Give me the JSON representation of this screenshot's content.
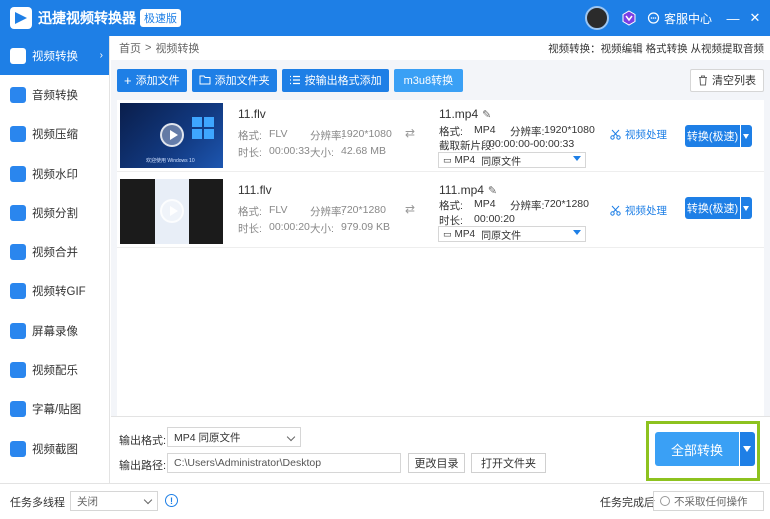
{
  "app": {
    "title": "迅捷视频转换器",
    "edition": "极速版",
    "support_label": "客服中心",
    "window_controls": [
      "minimize-icon",
      "close-icon"
    ]
  },
  "sidebar": {
    "items": [
      {
        "label": "视频转换",
        "icon": "video-convert-icon",
        "active": true
      },
      {
        "label": "音频转换",
        "icon": "audio-convert-icon"
      },
      {
        "label": "视频压缩",
        "icon": "video-compress-icon"
      },
      {
        "label": "视频水印",
        "icon": "watermark-icon"
      },
      {
        "label": "视频分割",
        "icon": "split-icon"
      },
      {
        "label": "视频合并",
        "icon": "merge-icon"
      },
      {
        "label": "视频转GIF",
        "icon": "gif-icon"
      },
      {
        "label": "屏幕录像",
        "icon": "screen-record-icon"
      },
      {
        "label": "视频配乐",
        "icon": "music-icon"
      },
      {
        "label": "字幕/贴图",
        "icon": "subtitle-icon"
      },
      {
        "label": "视频截图",
        "icon": "screenshot-icon"
      }
    ]
  },
  "breadcrumb": {
    "home": "首页",
    "sep": ">",
    "current": "视频转换",
    "quick_links": "视频转换：视频编辑 格式转换 从视频提取音频"
  },
  "toolbar": {
    "add_file": "添加文件",
    "add_folder": "添加文件夹",
    "add_by_format": "按输出格式添加",
    "m3u8": "m3u8转换",
    "clear_list": "清空列表"
  },
  "files": [
    {
      "src_name": "11.flv",
      "format_label": "格式:",
      "format": "FLV",
      "res_label": "分辨率:",
      "resolution": "1920*1080",
      "duration_label": "时长:",
      "duration": "00:00:33",
      "size_label": "大小:",
      "size": "42.68 MB",
      "out_name": "11.mp4",
      "out_format_label": "格式:",
      "out_format": "MP4",
      "out_res_label": "分辨率:",
      "out_resolution": "1920*1080",
      "clip_label": "截取新片段:",
      "clip": "00:00:00-00:00:33",
      "preset": "MP4",
      "preset_quality": "同原文件",
      "thumb_caption": "欢迎使用 Windows 10",
      "process_label": "视频处理",
      "convert_label": "转换(极速)"
    },
    {
      "src_name": "111.flv",
      "format_label": "格式:",
      "format": "FLV",
      "res_label": "分辨率:",
      "resolution": "720*1280",
      "duration_label": "时长:",
      "duration": "00:00:20",
      "size_label": "大小:",
      "size": "979.09 KB",
      "out_name": "111.mp4",
      "out_format_label": "格式:",
      "out_format": "MP4",
      "out_res_label": "分辨率:",
      "out_resolution": "720*1280",
      "out_duration_label": "时长:",
      "out_duration": "00:00:20",
      "preset": "MP4",
      "preset_quality": "同原文件",
      "process_label": "视频处理",
      "convert_label": "转换(极速)"
    }
  ],
  "output": {
    "format_label": "输出格式:",
    "format_value": "MP4  同原文件",
    "path_label": "输出路径:",
    "path_value": "C:\\Users\\Administrator\\Desktop",
    "change_dir": "更改目录",
    "open_folder": "打开文件夹",
    "convert_all": "全部转换"
  },
  "status": {
    "threads_label": "任务多线程",
    "threads_value": "关闭",
    "done_label": "任务完成后",
    "done_value": "不采取任何操作"
  },
  "colors": {
    "primary": "#1e7fe6",
    "highlight_border": "#8dc21f"
  }
}
